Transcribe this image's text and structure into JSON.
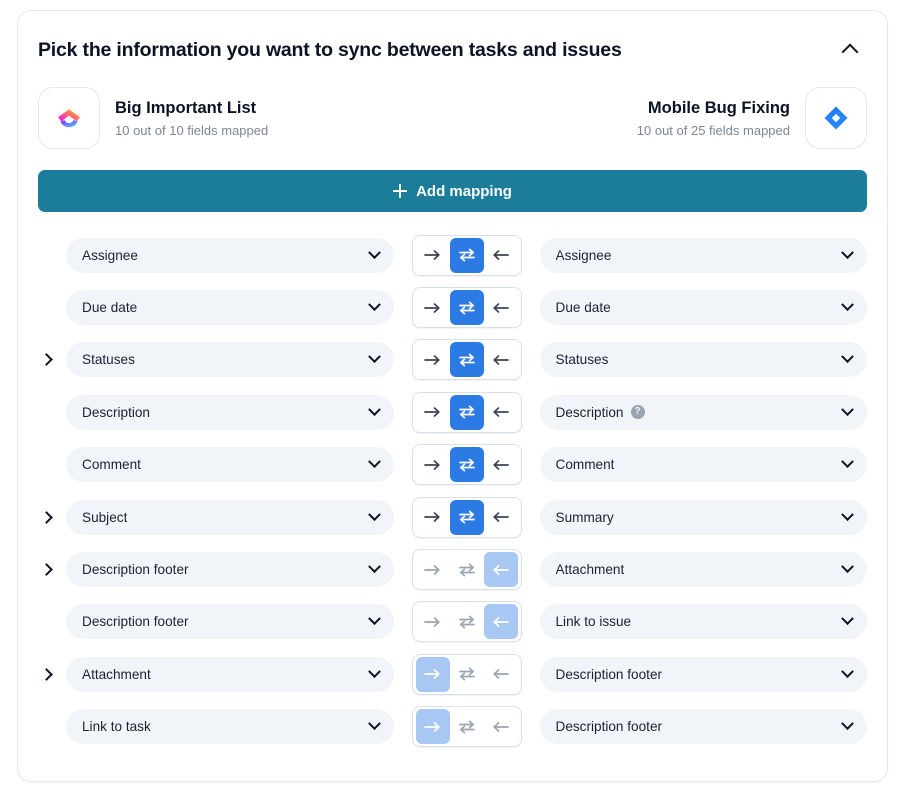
{
  "header": {
    "title": "Pick the information you want to sync between tasks and issues",
    "collapse_icon": "chevron-up-icon"
  },
  "apps": {
    "left": {
      "name": "Big Important List",
      "fields_mapped": "10 out of 10 fields mapped",
      "logo_icon": "clickup-logo-icon"
    },
    "right": {
      "name": "Mobile Bug Fixing",
      "fields_mapped": "10 out of 25 fields mapped",
      "logo_icon": "jira-logo-icon"
    }
  },
  "toolbar": {
    "add_mapping_label": "Add mapping",
    "add_mapping_icon": "plus-icon",
    "add_mapping_color": "#1B7D99"
  },
  "icons": {
    "help": "?",
    "expand": "chevron-right-icon",
    "dropdown": "chevron-down-icon",
    "arrow_right": "arrow-right-icon",
    "arrow_both": "arrow-bidirectional-icon",
    "arrow_left": "arrow-left-icon"
  },
  "colors": {
    "active_blue": "#2C7BE5",
    "muted_blue": "#A8C8F3",
    "field_background": "#F1F4F9",
    "accent_teal": "#1B7D99"
  },
  "mappings": [
    {
      "left": "Assignee",
      "left_expandable": false,
      "right": "Assignee",
      "right_help": false,
      "direction": "both",
      "muted": false
    },
    {
      "left": "Due date",
      "left_expandable": false,
      "right": "Due date",
      "right_help": false,
      "direction": "both",
      "muted": false
    },
    {
      "left": "Statuses",
      "left_expandable": true,
      "right": "Statuses",
      "right_help": false,
      "direction": "both",
      "muted": false
    },
    {
      "left": "Description",
      "left_expandable": false,
      "right": "Description",
      "right_help": true,
      "direction": "both",
      "muted": false
    },
    {
      "left": "Comment",
      "left_expandable": false,
      "right": "Comment",
      "right_help": false,
      "direction": "both",
      "muted": false
    },
    {
      "left": "Subject",
      "left_expandable": true,
      "right": "Summary",
      "right_help": false,
      "direction": "both",
      "muted": false
    },
    {
      "left": "Description footer",
      "left_expandable": true,
      "right": "Attachment",
      "right_help": false,
      "direction": "left",
      "muted": true
    },
    {
      "left": "Description footer",
      "left_expandable": false,
      "right": "Link to issue",
      "right_help": false,
      "direction": "left",
      "muted": true
    },
    {
      "left": "Attachment",
      "left_expandable": true,
      "right": "Description footer",
      "right_help": false,
      "direction": "right",
      "muted": true
    },
    {
      "left": "Link to task",
      "left_expandable": false,
      "right": "Description footer",
      "right_help": false,
      "direction": "right",
      "muted": true
    }
  ]
}
